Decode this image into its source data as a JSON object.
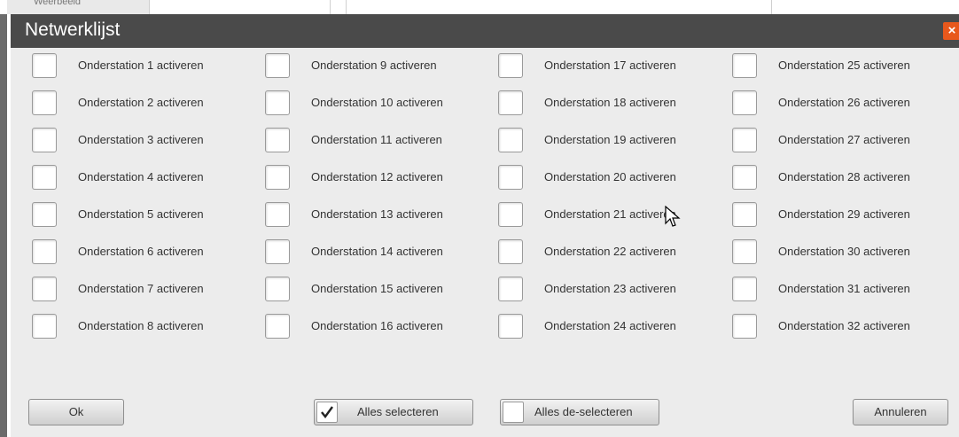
{
  "background": {
    "tab_label": "Weerbeeld"
  },
  "dialog": {
    "title": "Netwerklijst",
    "close_glyph": "×",
    "checkboxes": [
      "Onderstation 1 activeren",
      "Onderstation 2 activeren",
      "Onderstation 3 activeren",
      "Onderstation 4 activeren",
      "Onderstation 5 activeren",
      "Onderstation 6 activeren",
      "Onderstation 7 activeren",
      "Onderstation 8 activeren",
      "Onderstation 9 activeren",
      "Onderstation 10 activeren",
      "Onderstation 11 activeren",
      "Onderstation 12 activeren",
      "Onderstation 13 activeren",
      "Onderstation 14 activeren",
      "Onderstation 15 activeren",
      "Onderstation 16 activeren",
      "Onderstation 17 activeren",
      "Onderstation 18 activeren",
      "Onderstation 19 activeren",
      "Onderstation 20 activeren",
      "Onderstation 21 activeren",
      "Onderstation 22 activeren",
      "Onderstation 23 activeren",
      "Onderstation 24 activeren",
      "Onderstation 25 activeren",
      "Onderstation 26 activeren",
      "Onderstation 27 activeren",
      "Onderstation 28 activeren",
      "Onderstation 29 activeren",
      "Onderstation 30 activeren",
      "Onderstation 31 activeren",
      "Onderstation 32 activeren"
    ],
    "buttons": {
      "ok": "Ok",
      "select_all": "Alles selecteren",
      "select_all_checked": true,
      "deselect_all": "Alles de-selecteren",
      "deselect_all_checked": false,
      "cancel": "Annuleren"
    }
  },
  "colors": {
    "titlebar": "#4a4a4a",
    "dialog_bg": "#ececec",
    "close_accent": "#e8581c"
  }
}
